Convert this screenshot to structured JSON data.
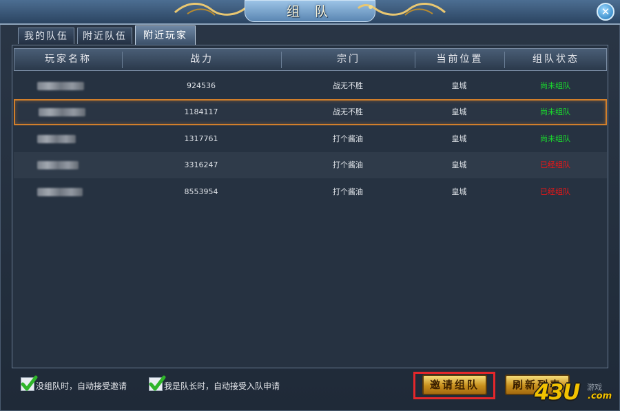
{
  "window": {
    "title": "组 队",
    "close_icon": "close-icon"
  },
  "tabs": [
    {
      "label": "我的队伍",
      "active": false
    },
    {
      "label": "附近队伍",
      "active": false
    },
    {
      "label": "附近玩家",
      "active": true
    }
  ],
  "table": {
    "columns": [
      "玩家名称",
      "战力",
      "宗门",
      "当前位置",
      "组队状态"
    ],
    "rows": [
      {
        "power": "924536",
        "sect": "战无不胜",
        "location": "皇城",
        "status": "尚未组队",
        "status_color": "#19e02c"
      },
      {
        "power": "1184117",
        "sect": "战无不胜",
        "location": "皇城",
        "status": "尚未组队",
        "status_color": "#19e02c",
        "selected": true
      },
      {
        "power": "1317761",
        "sect": "打个酱油",
        "location": "皇城",
        "status": "尚未组队",
        "status_color": "#19e02c"
      },
      {
        "power": "3316247",
        "sect": "打个酱油",
        "location": "皇城",
        "status": "已经组队",
        "status_color": "#f01515"
      },
      {
        "power": "8553954",
        "sect": "打个酱油",
        "location": "皇城",
        "status": "已经组队",
        "status_color": "#f01515"
      }
    ]
  },
  "options": {
    "auto_accept_invite": {
      "label": "没组队时，自动接受邀请",
      "checked": true
    },
    "auto_accept_join": {
      "label": "我是队长时，自动接受入队申请",
      "checked": true
    }
  },
  "buttons": {
    "invite": "邀请组队",
    "refresh": "刷新列表"
  },
  "watermark": {
    "brand": "43U",
    "domain": ".com",
    "caption": "游戏"
  }
}
